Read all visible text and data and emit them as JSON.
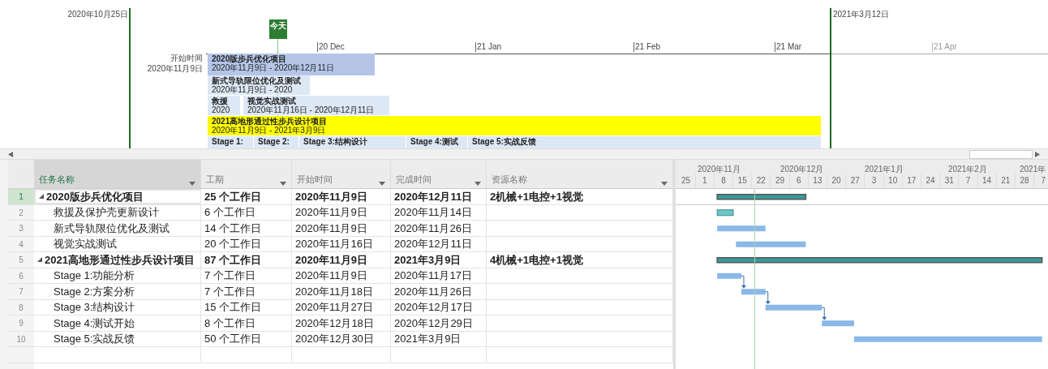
{
  "timeline": {
    "start_label": "2020年10月25日",
    "finish_label": "2021年3月12日",
    "today_label": "今天",
    "start_caption": "开始时间",
    "start_date": "2020年11月9日",
    "axis_labels": [
      {
        "text": "20 Dec",
        "past_finish": false
      },
      {
        "text": "21 Jan",
        "past_finish": false
      },
      {
        "text": "21 Feb",
        "past_finish": false
      },
      {
        "text": "21 Mar",
        "past_finish": false
      },
      {
        "text": "21 Apr",
        "past_finish": true
      }
    ],
    "bars": [
      {
        "title": "2020版步兵优化项目",
        "dates": "2020年11月9日 - 2020年12月11日",
        "color": "#b4c5e7"
      },
      {
        "title": "新式导轨限位优化及测试",
        "dates": "2020年11月9日 - 2020",
        "color": "#dde8f5"
      },
      {
        "title": "救援",
        "dates": "2020",
        "color": "#dde8f5"
      },
      {
        "title": "视觉实战测试",
        "dates": "2020年11月16日 - 2020年12月11日",
        "color": "#dde8f5"
      },
      {
        "title": "2021高地形通过性步兵设计项目",
        "dates": "2020年11月9日 - 2021年3月9日",
        "color": "#ffff00"
      }
    ],
    "stages": [
      {
        "title": "Stage 1:",
        "color": "#dde8f5"
      },
      {
        "title": "Stage 2:",
        "color": "#dde8f5"
      },
      {
        "title": "Stage 3:结构设计",
        "color": "#dde8f5"
      },
      {
        "title": "Stage 4:测试",
        "color": "#dde8f5"
      },
      {
        "title": "Stage 5:实战反馈",
        "color": "#dde8f5"
      }
    ]
  },
  "table": {
    "columns": [
      {
        "label": "任务名称",
        "selected": true
      },
      {
        "label": "工期",
        "selected": false
      },
      {
        "label": "开始时间",
        "selected": false
      },
      {
        "label": "完成时间",
        "selected": false
      },
      {
        "label": "资源名称",
        "selected": false
      }
    ],
    "rows": [
      {
        "number": "1",
        "kind": "summary",
        "expanded": true,
        "selected": true,
        "name": "2020版步兵优化项目",
        "duration": "25 个工作日",
        "start": "2020年11月9日",
        "finish": "2020年12月11日",
        "resources": "2机械+1电控+1视觉"
      },
      {
        "number": "2",
        "kind": "task",
        "selected": false,
        "name": "救援及保护壳更新设计",
        "duration": "6 个工作日",
        "start": "2020年11月9日",
        "finish": "2020年11月14日"
      },
      {
        "number": "3",
        "kind": "task",
        "selected": false,
        "name": "新式导轨限位优化及测试",
        "duration": "14 个工作日",
        "start": "2020年11月9日",
        "finish": "2020年11月26日"
      },
      {
        "number": "4",
        "kind": "task",
        "selected": false,
        "name": "视觉实战测试",
        "duration": "20 个工作日",
        "start": "2020年11月16日",
        "finish": "2020年12月11日"
      },
      {
        "number": "5",
        "kind": "summary",
        "expanded": true,
        "selected": false,
        "name": "2021高地形通过性步兵设计项目",
        "duration": "87 个工作日",
        "start": "2020年11月9日",
        "finish": "2021年3月9日",
        "resources": "4机械+1电控+1视觉"
      },
      {
        "number": "6",
        "kind": "task",
        "selected": false,
        "name": "Stage 1:功能分析",
        "duration": "7 个工作日",
        "start": "2020年11月9日",
        "finish": "2020年11月17日"
      },
      {
        "number": "7",
        "kind": "task",
        "selected": false,
        "name": "Stage 2:方案分析",
        "duration": "7 个工作日",
        "start": "2020年11月18日",
        "finish": "2020年11月26日"
      },
      {
        "number": "8",
        "kind": "task",
        "selected": false,
        "name": "Stage 3:结构设计",
        "duration": "15 个工作日",
        "start": "2020年11月27日",
        "finish": "2020年12月17日"
      },
      {
        "number": "9",
        "kind": "task",
        "selected": false,
        "name": "Stage 4:测试开始",
        "duration": "8 个工作日",
        "start": "2020年12月18日",
        "finish": "2020年12月29日"
      },
      {
        "number": "10",
        "kind": "task",
        "selected": false,
        "name": "Stage 5:实战反馈",
        "duration": "50 个工作日",
        "start": "2020年12月30日",
        "finish": "2021年3月9日"
      }
    ]
  },
  "gantt": {
    "months": [
      "2020年11月",
      "2020年12月",
      "2021年1月",
      "2021年2月",
      "2021年"
    ],
    "weeks": [
      "25",
      "1",
      "8",
      "15",
      "22",
      "29",
      "6",
      "13",
      "20",
      "27",
      "3",
      "10",
      "17",
      "24",
      "31",
      "7",
      "14",
      "21",
      "28",
      "7"
    ]
  }
}
